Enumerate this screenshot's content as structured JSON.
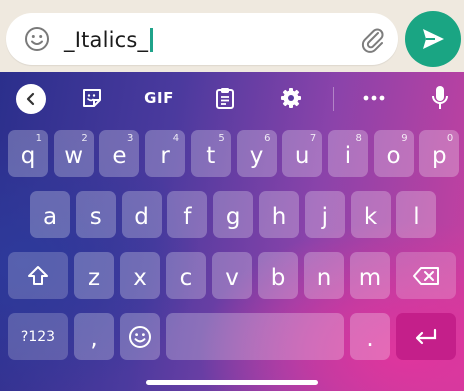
{
  "message": {
    "text": "_Italics_",
    "accent_color": "#1fa38a"
  },
  "icons": {
    "emoji": "smiley-icon",
    "attach": "paperclip-icon",
    "send": "send-icon",
    "back": "chevron-left-icon",
    "sticker": "sticker-icon",
    "clipboard": "clipboard-icon",
    "settings": "gear-icon",
    "more": "more-dots-icon",
    "mic": "microphone-icon"
  },
  "toolbar": {
    "gif_label": "GIF"
  },
  "keys": {
    "row1": [
      {
        "ch": "q",
        "hint": "1"
      },
      {
        "ch": "w",
        "hint": "2"
      },
      {
        "ch": "e",
        "hint": "3"
      },
      {
        "ch": "r",
        "hint": "4"
      },
      {
        "ch": "t",
        "hint": "5"
      },
      {
        "ch": "y",
        "hint": "6"
      },
      {
        "ch": "u",
        "hint": "7"
      },
      {
        "ch": "i",
        "hint": "8"
      },
      {
        "ch": "o",
        "hint": "9"
      },
      {
        "ch": "p",
        "hint": "0"
      }
    ],
    "row2": [
      "a",
      "s",
      "d",
      "f",
      "g",
      "h",
      "j",
      "k",
      "l"
    ],
    "row3": [
      "z",
      "x",
      "c",
      "v",
      "b",
      "n",
      "m"
    ],
    "row4": {
      "symbols_label": "?123",
      "comma": ",",
      "period": "."
    }
  },
  "colors": {
    "send_button": "#1aa583",
    "enter_key": "#c41f8a"
  }
}
